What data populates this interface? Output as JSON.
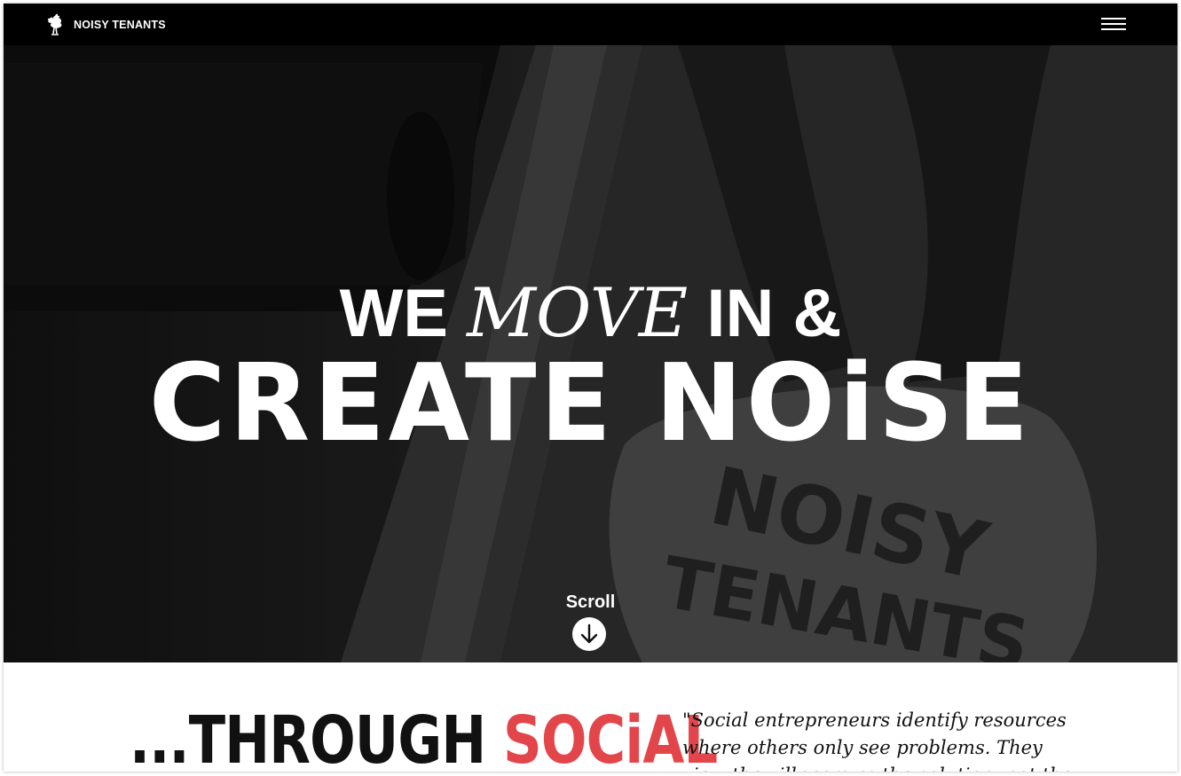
{
  "header": {
    "brand": "NOISY TENANTS",
    "logo_icon": "rooster-icon",
    "menu_icon": "hamburger-menu-icon"
  },
  "hero": {
    "line1_part1": "WE ",
    "line1_move": "MOVE",
    "line1_part2": " IN &",
    "line2": "CREATE NOiSE",
    "scroll_label": "Scroll",
    "scroll_icon": "arrow-down-circle-icon"
  },
  "intro": {
    "heading_prefix": "...",
    "heading_word1": "THROUGH",
    "heading_word2": "SOCiAL",
    "quote": "\"Social entrepreneurs identify resources where others only see problems. They view the villagers as the solution, not the"
  },
  "colors": {
    "topbar": "#000000",
    "accent_red": "#e2464b",
    "text_dark": "#111111",
    "hero_text": "#ffffff"
  }
}
